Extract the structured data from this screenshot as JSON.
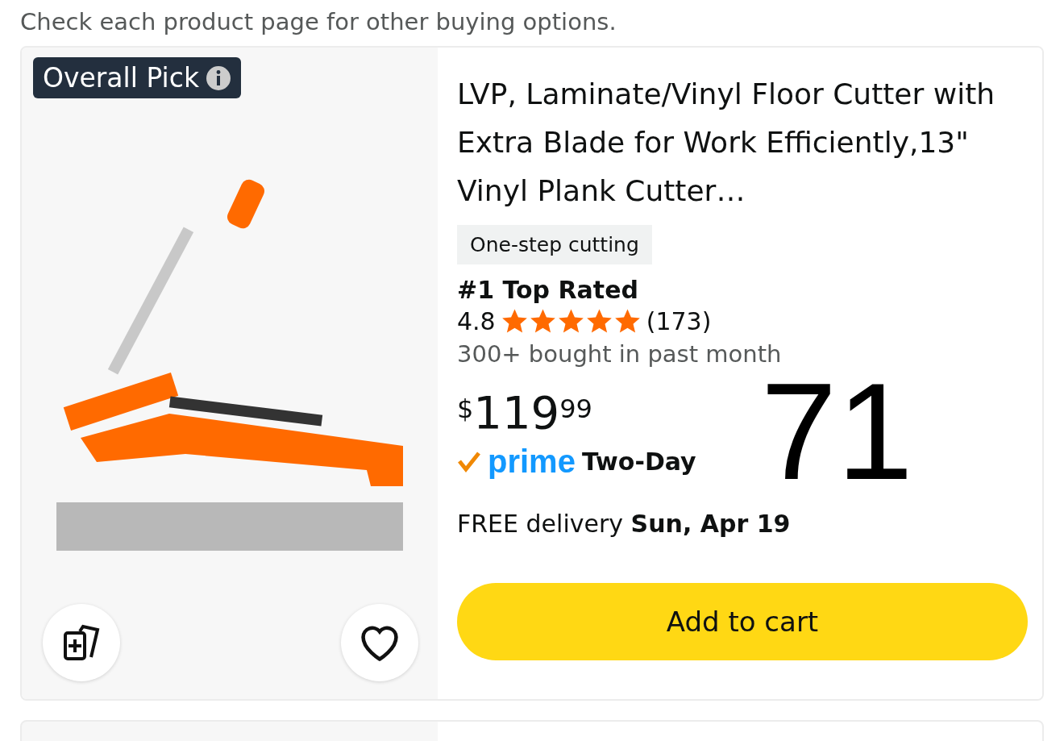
{
  "header_note": "Check each product page for other buying options.",
  "products": [
    {
      "badge": "Overall Pick",
      "title": "LVP, Laminate/Vinyl Floor Cutter with Extra Blade for Work Efficiently,13\" Vinyl Plank Cutter…",
      "tag": "One-step cutting",
      "rank": "#1 Top Rated",
      "rating": "4.8",
      "stars": 5,
      "review_count": "(173)",
      "bought": "300+ bought in past month",
      "price": {
        "currency": "$",
        "whole": "119",
        "fraction": "99"
      },
      "side_number": "71",
      "prime_word": "prime",
      "shipping_speed": "Two-Day",
      "delivery": "FREE delivery **Sun, Apr 19**",
      "favorited": false,
      "button": "Add to cart"
    }
  ]
}
